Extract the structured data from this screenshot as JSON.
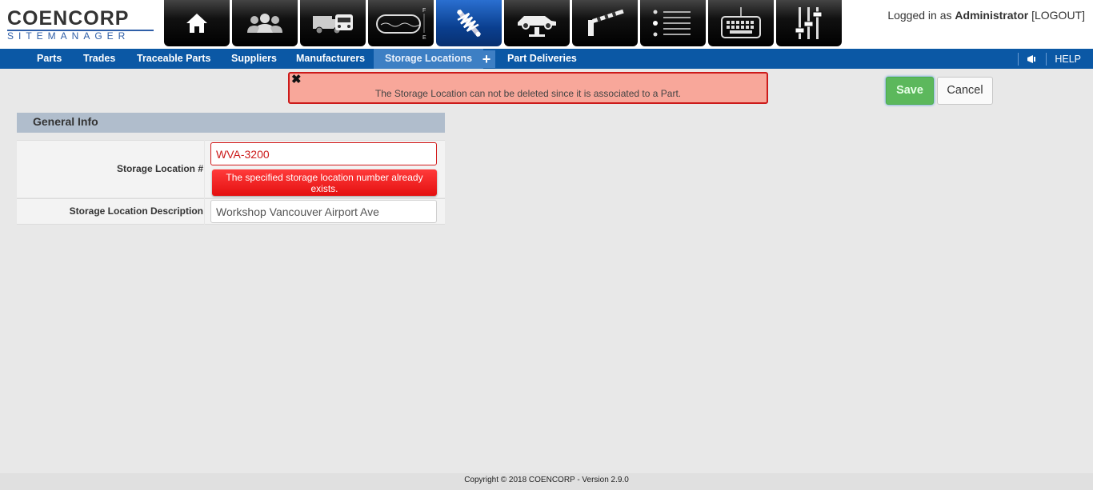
{
  "brand": {
    "name": "COENCORP",
    "product": "SITEMANAGER"
  },
  "modules": [
    {
      "icon": "home-icon"
    },
    {
      "icon": "users-icon"
    },
    {
      "icon": "trucks-icon"
    },
    {
      "icon": "fuel-tank-icon"
    },
    {
      "icon": "shock-absorber-icon",
      "active": true
    },
    {
      "icon": "car-lift-icon"
    },
    {
      "icon": "barrier-gate-icon"
    },
    {
      "icon": "list-icon"
    },
    {
      "icon": "keyboard-icon"
    },
    {
      "icon": "sliders-icon"
    }
  ],
  "user": {
    "prefix": "Logged in as",
    "name": "Administrator",
    "logout": "[LOGOUT]"
  },
  "nav": {
    "items": [
      "Parts",
      "Trades",
      "Traceable Parts",
      "Suppliers",
      "Manufacturers",
      "Storage Locations",
      "Part Deliveries"
    ],
    "active": "Storage Locations",
    "add_symbol": "+",
    "help": "HELP"
  },
  "alert": {
    "close": "✖",
    "message": "The Storage Location can not be deleted since it is associated to a Part."
  },
  "actions": {
    "save": "Save",
    "cancel": "Cancel"
  },
  "section": {
    "title": "General Info"
  },
  "form": {
    "location_number": {
      "label": "Storage Location #",
      "value": "WVA-3200",
      "error": "The specified storage location number already exists."
    },
    "description": {
      "label": "Storage Location Description",
      "value": "Workshop Vancouver Airport Ave"
    }
  },
  "footer": {
    "text": "Copyright © 2018 COENCORP - Version 2.9.0"
  },
  "colors": {
    "nav": "#0b58a5",
    "nav_active": "#3d7fc4",
    "save": "#5cb85c",
    "error": "#e41010",
    "alert_bg": "#f8a79a"
  }
}
